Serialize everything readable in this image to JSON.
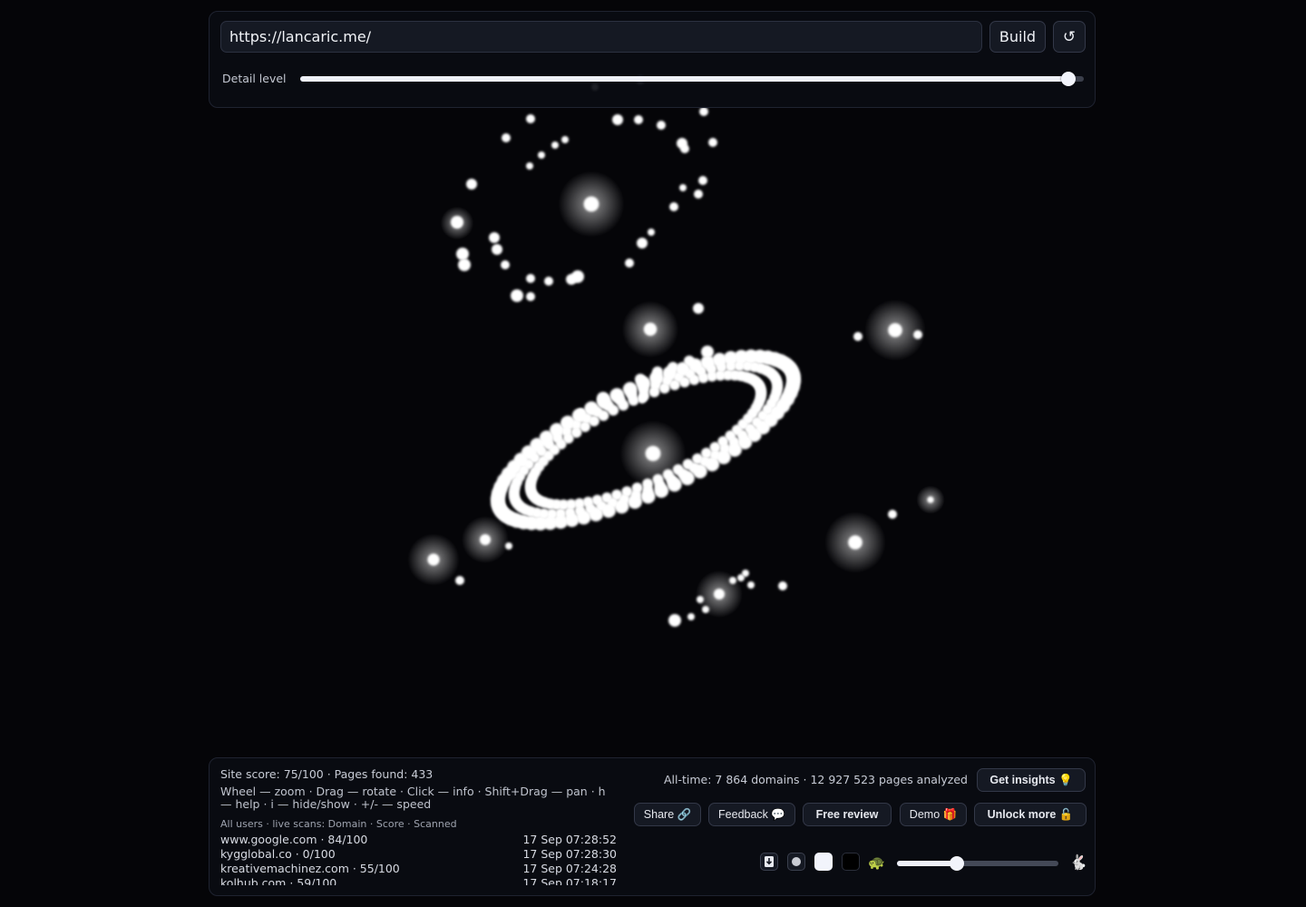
{
  "top_bar": {
    "url_value": "https://lancaric.me/",
    "build_label": "Build",
    "reset_icon": "↺",
    "detail_label": "Detail level",
    "detail_level": 0.98
  },
  "stats": {
    "site_line": "Site score: 75/100 · Pages found: 433",
    "help_line": "Wheel — zoom · Drag — rotate · Click — info · Shift+Drag — pan · h — help · i — hide/show · +/- — speed",
    "all_time": "All-time: 7 864 domains · 12 927 523 pages analyzed"
  },
  "live_scans": {
    "header": "All users · live scans: Domain · Score · Scanned",
    "rows": [
      {
        "domain": "www.google.com · 84/100",
        "time": "17 Sep 07:28:52"
      },
      {
        "domain": "kygglobal.co · 0/100",
        "time": "17 Sep 07:28:30"
      },
      {
        "domain": "kreativemachinez.com · 55/100",
        "time": "17 Sep 07:24:28"
      },
      {
        "domain": "kolhub.com · 59/100",
        "time": "17 Sep 07:18:17"
      }
    ]
  },
  "actions": {
    "get_insights": "Get insights 💡",
    "share": "Share 🔗",
    "feedback": "Feedback 💬",
    "free_review": "Free review",
    "demo": "Demo 🎁",
    "unlock_more": "Unlock more 🔓"
  },
  "controls": {
    "download_icon": "download-icon",
    "turtle": "🐢",
    "rabbit": "🐇",
    "speed_level": 0.37
  },
  "colors": {
    "background": "#050508",
    "panel": "#0a0c12",
    "node": "#ffffff"
  }
}
